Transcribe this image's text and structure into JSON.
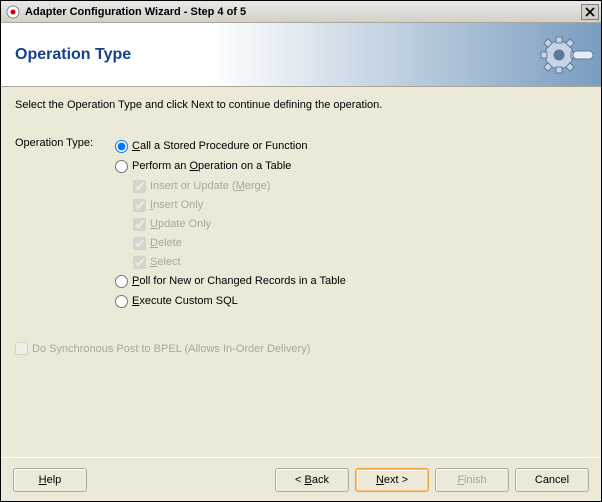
{
  "window": {
    "title": "Adapter Configuration Wizard - Step 4 of 5"
  },
  "header": {
    "title": "Operation Type"
  },
  "instruction": "Select the Operation Type and click Next to continue defining the operation.",
  "operation": {
    "label": "Operation Type:",
    "options": {
      "call_sp": {
        "pre": "",
        "u": "C",
        "post": "all a Stored Procedure or Function",
        "selected": true
      },
      "perform": {
        "pre": "Perform an ",
        "u": "O",
        "post": "peration on a Table",
        "selected": false
      },
      "poll": {
        "pre": "",
        "u": "P",
        "post": "oll for New or Changed Records in a Table",
        "selected": false
      },
      "custom": {
        "pre": "",
        "u": "E",
        "post": "xecute Custom SQL",
        "selected": false
      }
    },
    "sub_checks": {
      "merge": {
        "pre": "Insert or Update (",
        "u": "M",
        "post": "erge)",
        "checked": true
      },
      "insert": {
        "pre": "",
        "u": "I",
        "post": "nsert Only",
        "checked": true
      },
      "update": {
        "pre": "",
        "u": "U",
        "post": "pdate Only",
        "checked": true
      },
      "delete": {
        "pre": "",
        "u": "D",
        "post": "elete",
        "checked": true
      },
      "select": {
        "pre": "",
        "u": "S",
        "post": "elect",
        "checked": true
      }
    }
  },
  "sync": {
    "label": "Do Synchronous Post to BPEL (Allows In-Order Delivery)",
    "checked": false,
    "enabled": false
  },
  "buttons": {
    "help": {
      "pre": "",
      "u": "H",
      "post": "elp"
    },
    "back": {
      "pre": "< ",
      "u": "B",
      "post": "ack"
    },
    "next": {
      "pre": "",
      "u": "N",
      "post": "ext >"
    },
    "finish": {
      "pre": "",
      "u": "F",
      "post": "inish",
      "enabled": false
    },
    "cancel": {
      "label": "Cancel"
    }
  }
}
